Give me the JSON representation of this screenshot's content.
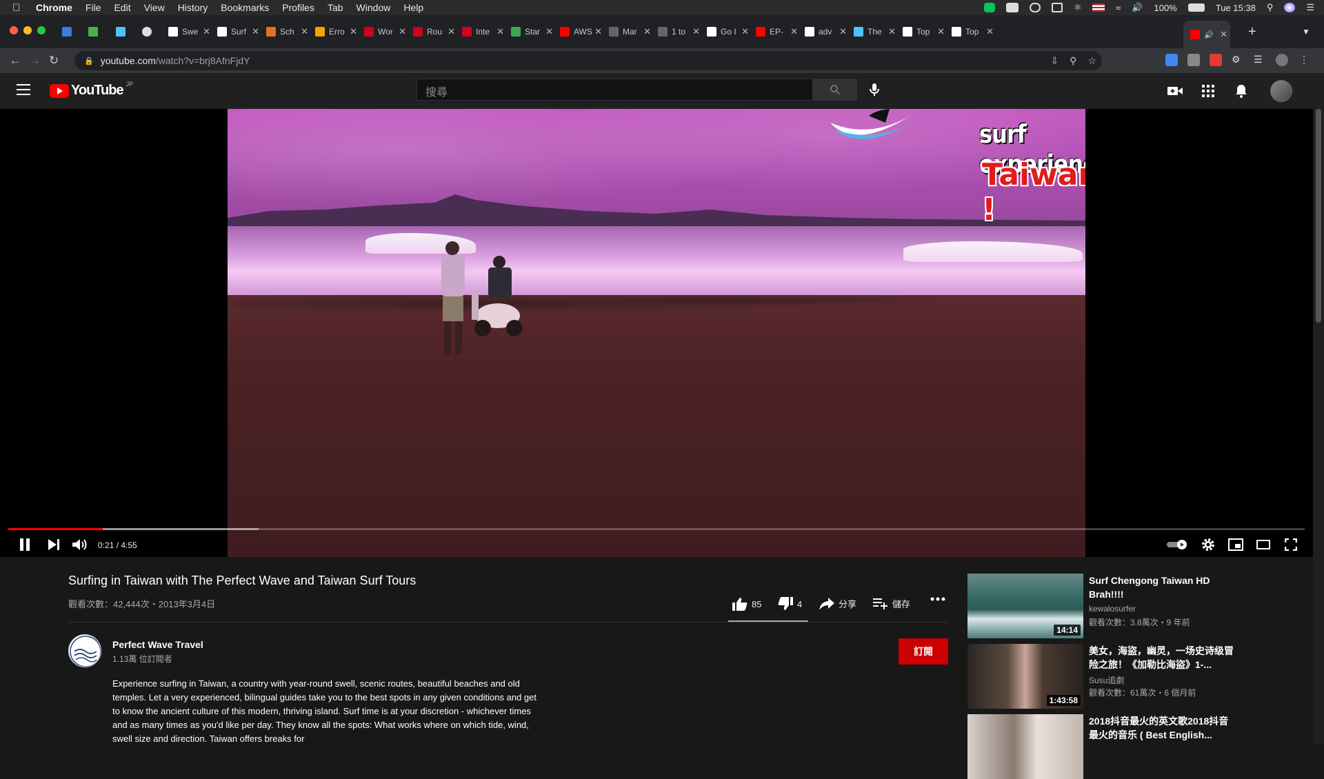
{
  "menubar": {
    "items": [
      "Chrome",
      "File",
      "Edit",
      "View",
      "History",
      "Bookmarks",
      "Profiles",
      "Tab",
      "Window",
      "Help"
    ],
    "battery": "100%",
    "clock": "Tue 15:38"
  },
  "tabs": [
    {
      "label": "Swe",
      "color": "#ffffff"
    },
    {
      "label": "Surf",
      "color": "#ffffff"
    },
    {
      "label": "Sch",
      "color": "#e8711c"
    },
    {
      "label": "Erro",
      "color": "#f4a300"
    },
    {
      "label": "Wor",
      "color": "#d0021b"
    },
    {
      "label": "Rou",
      "color": "#d0021b"
    },
    {
      "label": "Inte",
      "color": "#d0021b"
    },
    {
      "label": "Star",
      "color": "#3aa757"
    },
    {
      "label": "AWS",
      "color": "#ff0000"
    },
    {
      "label": "Mar",
      "color": "#666666"
    },
    {
      "label": "1 to",
      "color": "#666666"
    },
    {
      "label": "Go I",
      "color": "#ffffff"
    },
    {
      "label": "EP-",
      "color": "#ff0000"
    },
    {
      "label": "adv",
      "color": "#ffffff"
    },
    {
      "label": "The",
      "color": "#4fc3f7"
    },
    {
      "label": "Top",
      "color": "#ffffff"
    },
    {
      "label": "Top",
      "color": "#ffffff"
    }
  ],
  "address": {
    "host": "youtube.com",
    "path": "/watch?v=brj8AfnFjdY"
  },
  "youtube": {
    "logo_text": "YouTube",
    "region": "JP",
    "search_placeholder": "搜尋"
  },
  "video_overlay": {
    "brand_line1": "surf experience",
    "brand_line2": "Taiwan !"
  },
  "player": {
    "time": "0:21 / 4:55",
    "played_fraction": 0.0729,
    "buffered_fraction": 0.193
  },
  "video": {
    "title": "Surfing in Taiwan with The Perfect Wave and Taiwan Surf Tours",
    "meta": "觀看次數：42,444次・2013年3月4日",
    "likes": "85",
    "dislikes": "4",
    "share_label": "分享",
    "save_label": "儲存"
  },
  "channel": {
    "name": "Perfect Wave Travel",
    "subscribers": "1.13萬 位訂閱者",
    "subscribe_label": "訂閱"
  },
  "description": "Experience surfing in Taiwan, a country with year-round swell, scenic routes, beautiful beaches and old temples. Let a very experienced, bilingual guides take you to the best spots in any given conditions and get to know the ancient culture of this modern, thriving island. Surf time is at your discretion - whichever times and as many times as you'd like per day. They know all the spots: What works where on which tide, wind, swell size and direction. Taiwan offers breaks for",
  "recommendations": [
    {
      "title": "Surf Chengong Taiwan HD Brah!!!!",
      "channel": "kewalosurfer",
      "meta": "觀看次數：3.8萬次・9 年前",
      "duration": "14:14"
    },
    {
      "title": "美女，海盜，幽灵，一场史诗级冒险之旅！《加勒比海盜》1-...",
      "channel": "Susu追劇",
      "meta": "觀看次數：61萬次・6 個月前",
      "duration": "1:43:58"
    },
    {
      "title": "2018抖音最火的英文歌2018抖音最火的音乐 ( Best English...",
      "channel": "",
      "meta": "",
      "duration": ""
    }
  ]
}
